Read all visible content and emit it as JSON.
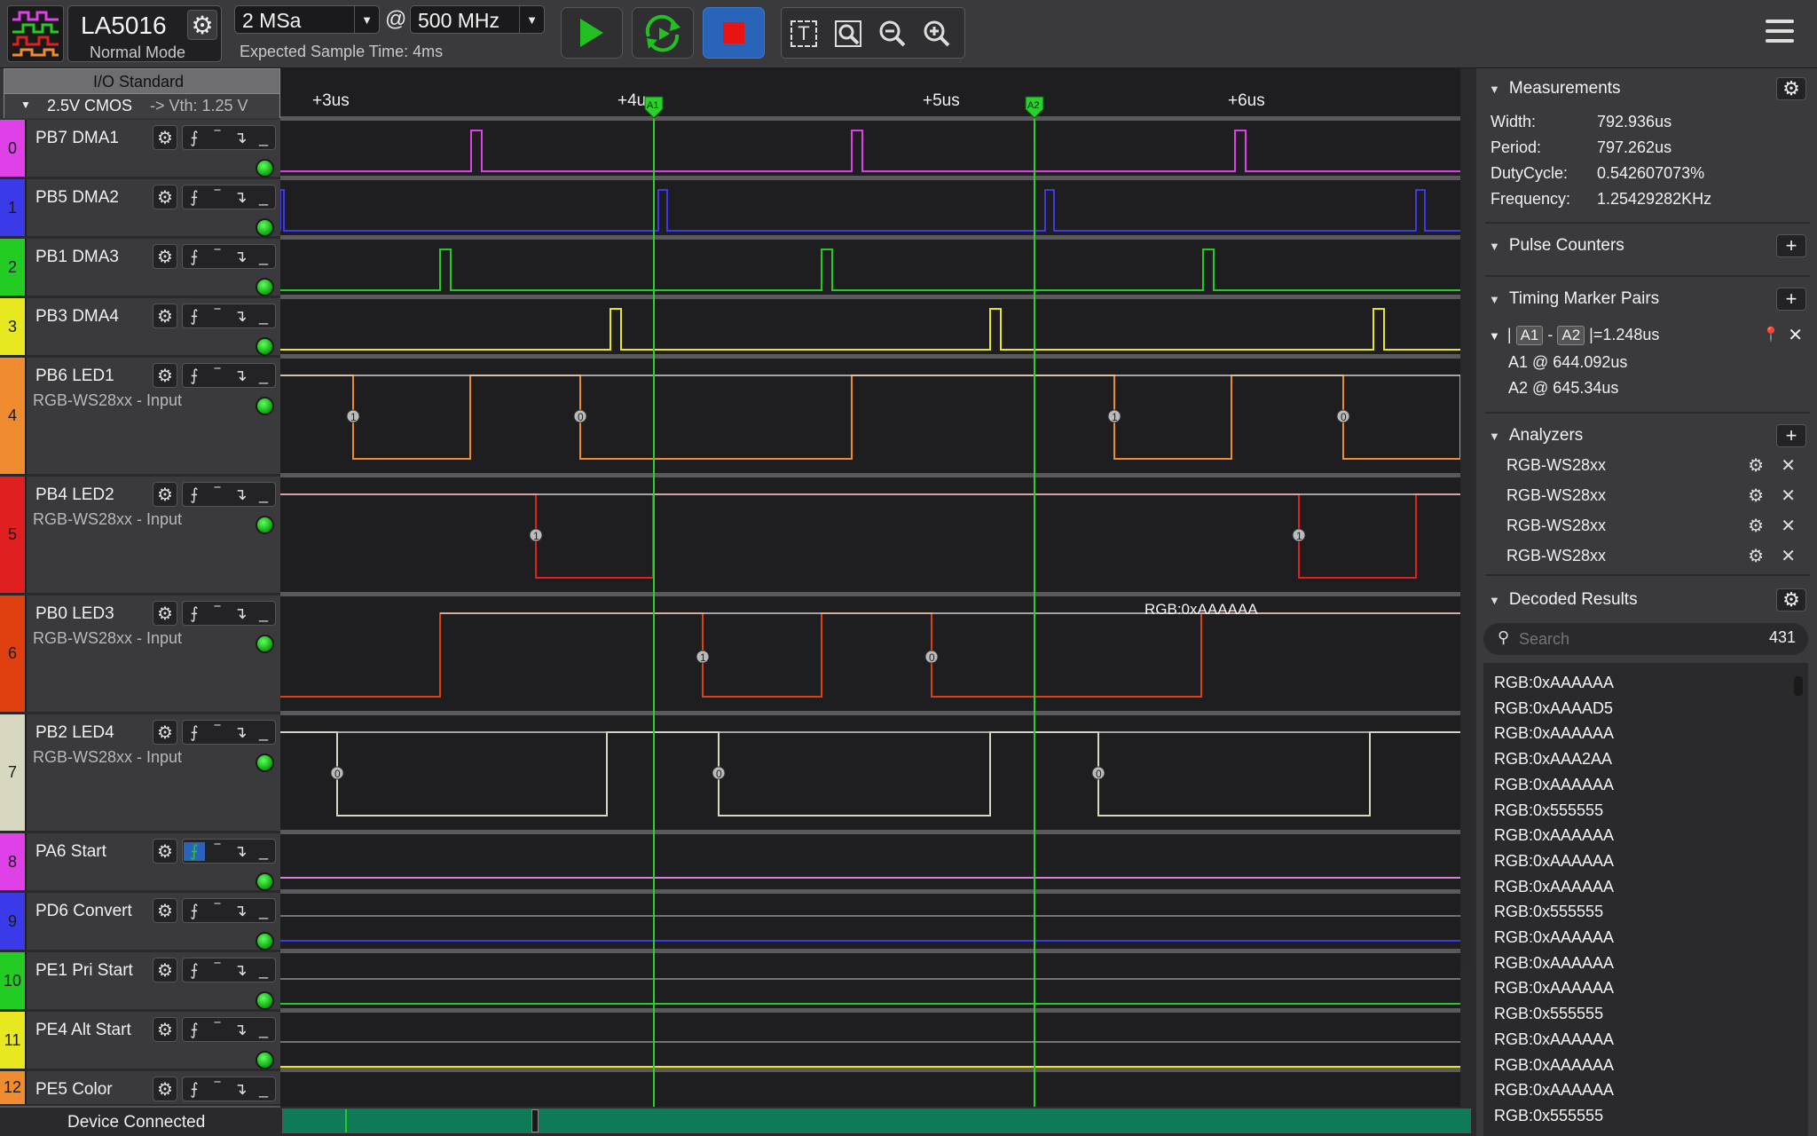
{
  "toolbar": {
    "device_name": "LA5016",
    "device_mode": "Normal Mode",
    "sample_depth": "2 MSa",
    "at_symbol": "@",
    "sample_rate": "500 MHz",
    "expected_time": "Expected Sample Time: 4ms"
  },
  "io_standard": {
    "title": "I/O Standard",
    "value": "2.5V CMOS",
    "vth": "-> Vth: 1.25 V"
  },
  "channels": [
    {
      "num": "0",
      "name": "PB7 DMA1",
      "sub": "",
      "color": "#e040e8"
    },
    {
      "num": "1",
      "name": "PB5 DMA2",
      "sub": "",
      "color": "#3a3ae8"
    },
    {
      "num": "2",
      "name": "PB1 DMA3",
      "sub": "",
      "color": "#22cc22"
    },
    {
      "num": "3",
      "name": "PB3 DMA4",
      "sub": "",
      "color": "#e8e820"
    },
    {
      "num": "4",
      "name": "PB6 LED1",
      "sub": "RGB-WS28xx - Input",
      "color": "#f08c30"
    },
    {
      "num": "5",
      "name": "PB4 LED2",
      "sub": "RGB-WS28xx - Input",
      "color": "#e02020"
    },
    {
      "num": "6",
      "name": "PB0 LED3",
      "sub": "RGB-WS28xx - Input",
      "color": "#e04010"
    },
    {
      "num": "7",
      "name": "PB2 LED4",
      "sub": "RGB-WS28xx - Input",
      "color": "#d8d8c0"
    },
    {
      "num": "8",
      "name": "PA6 Start",
      "sub": "",
      "color": "#e040e8"
    },
    {
      "num": "9",
      "name": "PD6 Convert",
      "sub": "",
      "color": "#3a3ae8"
    },
    {
      "num": "10",
      "name": "PE1 Pri Start",
      "sub": "",
      "color": "#22cc22"
    },
    {
      "num": "11",
      "name": "PE4 Alt Start",
      "sub": "",
      "color": "#e8e820"
    },
    {
      "num": "12",
      "name": "PE5 Color",
      "sub": "",
      "color": "#f08c30"
    }
  ],
  "status": "Device Connected",
  "timeline": {
    "labels": [
      "+3us",
      "+4us",
      "+5us",
      "+6us"
    ],
    "marker_a1": "A1",
    "marker_a2": "A2"
  },
  "waveform": {
    "bit_labels": [
      "1",
      "0",
      "1",
      "0",
      "1",
      "1",
      "1",
      "0",
      "0",
      "0",
      "0"
    ],
    "decoded_overlay": "RGB:0xAAAAAA"
  },
  "measurements": {
    "title": "Measurements",
    "width_label": "Width:",
    "width": "792.936us",
    "period_label": "Period:",
    "period": "797.262us",
    "duty_label": "DutyCycle:",
    "duty": "0.542607073%",
    "freq_label": "Frequency:",
    "freq": "1.25429282KHz"
  },
  "pulse_counters": {
    "title": "Pulse Counters"
  },
  "timing_markers": {
    "title": "Timing Marker Pairs",
    "a1": "A1",
    "a2": "A2",
    "delta": "=1.248us",
    "a1_line": "A1 @ 644.092us",
    "a2_line": "A2 @ 645.34us"
  },
  "analyzers": {
    "title": "Analyzers",
    "items": [
      "RGB-WS28xx",
      "RGB-WS28xx",
      "RGB-WS28xx",
      "RGB-WS28xx"
    ]
  },
  "decoded": {
    "title": "Decoded Results",
    "search_placeholder": "Search",
    "count": "431",
    "items": [
      "RGB:0xAAAAAA",
      "RGB:0xAAAAD5",
      "RGB:0xAAAAAA",
      "RGB:0xAAA2AA",
      "RGB:0xAAAAAA",
      "RGB:0x555555",
      "RGB:0xAAAAAA",
      "RGB:0xAAAAAA",
      "RGB:0xAAAAAA",
      "RGB:0x555555",
      "RGB:0xAAAAAA",
      "RGB:0xAAAAAA",
      "RGB:0xAAAAAA",
      "RGB:0x555555",
      "RGB:0xAAAAAA",
      "RGB:0xAAAAAA",
      "RGB:0xAAAAAA",
      "RGB:0x555555"
    ]
  }
}
